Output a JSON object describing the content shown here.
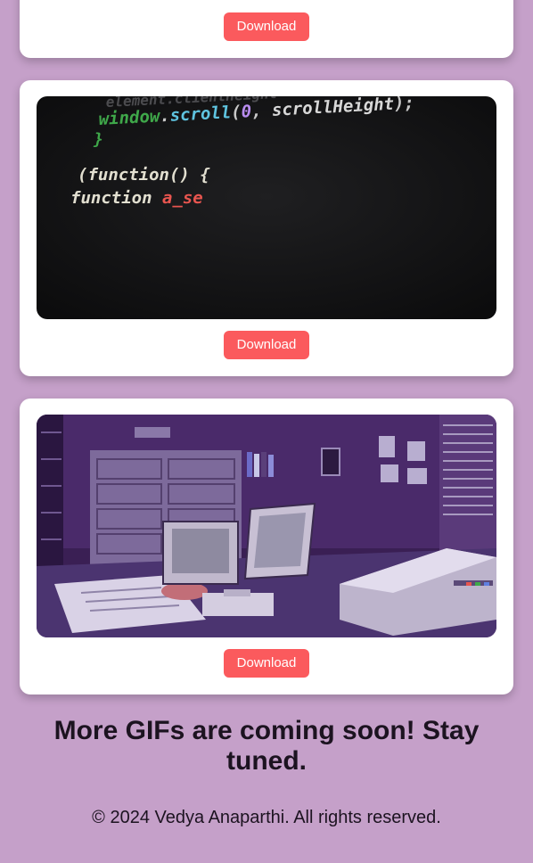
{
  "gifs": [
    {
      "name": "partial-top-gif",
      "download_label": "Download"
    },
    {
      "name": "code-gif",
      "download_label": "Download",
      "code_lines": [
        "element.clientHeight",
        "window.scroll(0, scrollHeight);",
        "}",
        "(function() {",
        "function a_se"
      ]
    },
    {
      "name": "retro-room-gif",
      "download_label": "Download"
    }
  ],
  "coming_soon": "More GIFs are coming soon! Stay tuned.",
  "footer": "© 2024 Vedya Anaparthi. All rights reserved.",
  "colors": {
    "background": "#c5a0c9",
    "card": "#ffffff",
    "button": "#fb5a5d",
    "text": "#1c1320"
  }
}
